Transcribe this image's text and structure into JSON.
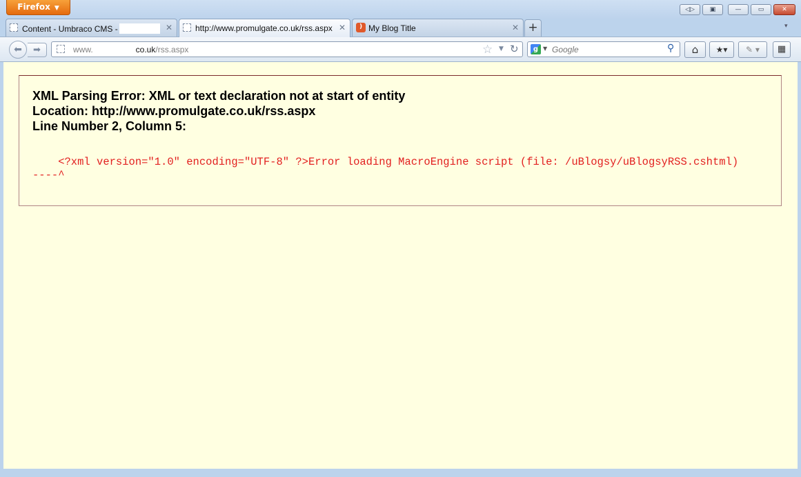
{
  "window": {
    "app_button_label": "Firefox",
    "controls": [
      "◁▷",
      "▣",
      "—",
      "▭",
      "✕"
    ]
  },
  "tabs": [
    {
      "label": "Content - Umbraco CMS -",
      "suffix": "..",
      "icon": "blank-page-icon",
      "active": false
    },
    {
      "label": "http://www.promulgate.co.uk/rss.aspx",
      "icon": "blank-page-icon",
      "active": true
    },
    {
      "label": "My Blog Title",
      "icon": "rss-feed-icon",
      "active": false
    }
  ],
  "navbar": {
    "url_prefix": "www.",
    "url_domain": "co.uk",
    "url_path": "/rss.aspx",
    "search_placeholder": "Google"
  },
  "error": {
    "title_line1": "XML Parsing Error: XML or text declaration not at start of entity",
    "title_line2": "Location: http://www.promulgate.co.uk/rss.aspx",
    "title_line3": "Line Number 2, Column 5:",
    "source_line1": "    <?xml version=\"1.0\" encoding=\"UTF-8\" ?>Error loading MacroEngine script (file: /uBlogsy/uBlogsyRSS.cshtml)",
    "source_line2": "----^"
  },
  "colors": {
    "page_background": "#ffffe1",
    "error_source_text": "#e21f1f",
    "firefox_button": "#e56a0e"
  }
}
